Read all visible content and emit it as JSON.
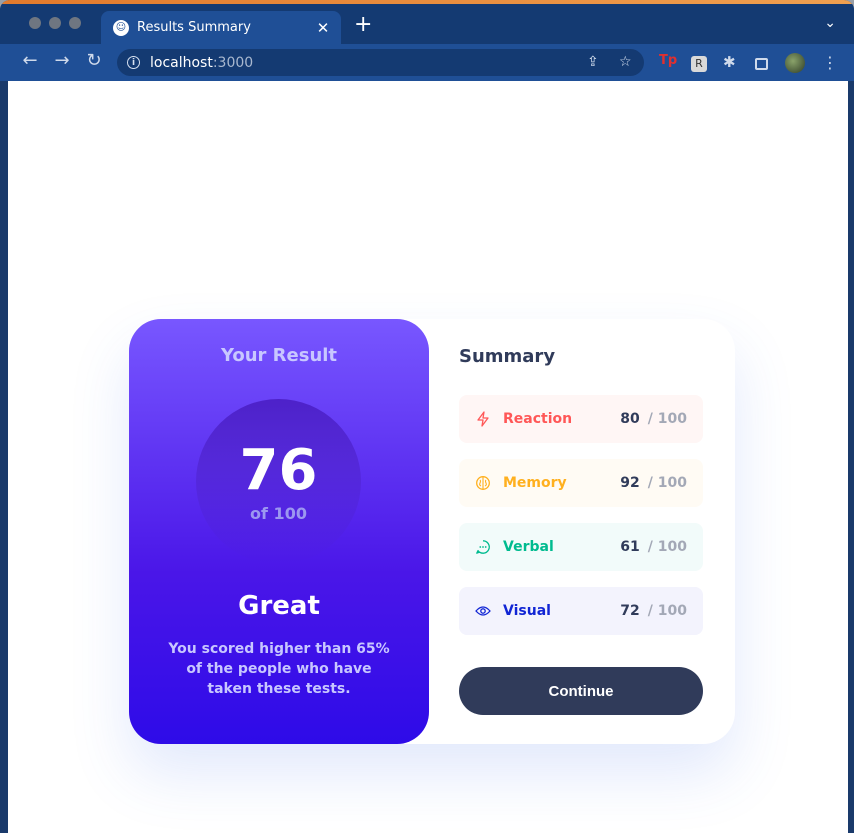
{
  "browser": {
    "tab_title": "Results Summary",
    "url_host": "localhost",
    "url_port": ":3000"
  },
  "result": {
    "heading": "Your Result",
    "score": "76",
    "score_of": "of 100",
    "grade": "Great",
    "description": "You scored higher than 65% of the people who have taken these tests."
  },
  "summary": {
    "heading": "Summary",
    "items": [
      {
        "label": "Reaction",
        "score": "80",
        "max": "/ 100",
        "icon": "lightning-icon",
        "color": "#FF5757",
        "bg": "#FFF6F5"
      },
      {
        "label": "Memory",
        "score": "92",
        "max": "/ 100",
        "icon": "brain-icon",
        "color": "#FFB01F",
        "bg": "#FFFBF4"
      },
      {
        "label": "Verbal",
        "score": "61",
        "max": "/ 100",
        "icon": "chat-bubble-icon",
        "color": "#00BB8F",
        "bg": "#F2FBFA"
      },
      {
        "label": "Visual",
        "score": "72",
        "max": "/ 100",
        "icon": "eye-icon",
        "color": "#1125D4",
        "bg": "#F3F3FD"
      }
    ],
    "continue_label": "Continue"
  }
}
